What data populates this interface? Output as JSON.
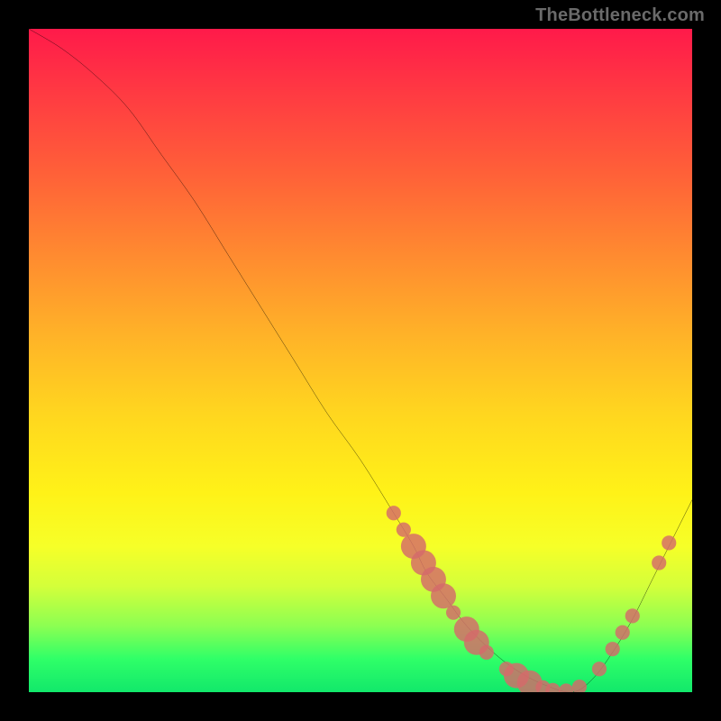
{
  "watermark": "TheBottleneck.com",
  "colors": {
    "page_bg": "#000000",
    "curve": "#000000",
    "dot_fill": "#d46a6a",
    "dot_stroke": "#d46a6a",
    "gradient_stops": [
      "#ff1a4a",
      "#ff3b42",
      "#ff6138",
      "#ff8a30",
      "#ffb228",
      "#ffd61f",
      "#fff218",
      "#f6ff28",
      "#d4ff3a",
      "#8cff52",
      "#2fff68",
      "#12e86b"
    ]
  },
  "chart_data": {
    "type": "line",
    "title": "",
    "xlabel": "",
    "ylabel": "",
    "xlim": [
      0,
      100
    ],
    "ylim": [
      0,
      100
    ],
    "x": [
      0,
      5,
      10,
      15,
      20,
      25,
      30,
      35,
      40,
      45,
      50,
      55,
      58,
      60,
      63,
      66,
      70,
      74,
      78,
      82,
      85,
      88,
      91,
      94,
      97,
      100
    ],
    "y": [
      100,
      97,
      93,
      88,
      81,
      74,
      66,
      58,
      50,
      42,
      35,
      27,
      22,
      18,
      14,
      10,
      6,
      3,
      1,
      0,
      2,
      6,
      11,
      17,
      23,
      29
    ],
    "markers": [
      {
        "x": 55,
        "y": 27,
        "r": 1.1
      },
      {
        "x": 56.5,
        "y": 24.5,
        "r": 1.1
      },
      {
        "x": 58,
        "y": 22,
        "r": 1.9
      },
      {
        "x": 59.5,
        "y": 19.5,
        "r": 1.9
      },
      {
        "x": 61,
        "y": 17,
        "r": 1.9
      },
      {
        "x": 62.5,
        "y": 14.5,
        "r": 1.9
      },
      {
        "x": 64,
        "y": 12,
        "r": 1.1
      },
      {
        "x": 66,
        "y": 9.5,
        "r": 1.9
      },
      {
        "x": 67.5,
        "y": 7.5,
        "r": 1.9
      },
      {
        "x": 69,
        "y": 6,
        "r": 1.1
      },
      {
        "x": 72,
        "y": 3.5,
        "r": 1.1
      },
      {
        "x": 73.5,
        "y": 2.5,
        "r": 1.9
      },
      {
        "x": 75.5,
        "y": 1.4,
        "r": 1.9
      },
      {
        "x": 77.5,
        "y": 0.7,
        "r": 1.1
      },
      {
        "x": 79,
        "y": 0.3,
        "r": 1.1
      },
      {
        "x": 81,
        "y": 0.2,
        "r": 1.1
      },
      {
        "x": 83,
        "y": 0.8,
        "r": 1.1
      },
      {
        "x": 86,
        "y": 3.5,
        "r": 1.1
      },
      {
        "x": 88,
        "y": 6.5,
        "r": 1.1
      },
      {
        "x": 89.5,
        "y": 9,
        "r": 1.1
      },
      {
        "x": 91,
        "y": 11.5,
        "r": 1.1
      },
      {
        "x": 95,
        "y": 19.5,
        "r": 1.1
      },
      {
        "x": 96.5,
        "y": 22.5,
        "r": 1.1
      }
    ]
  }
}
